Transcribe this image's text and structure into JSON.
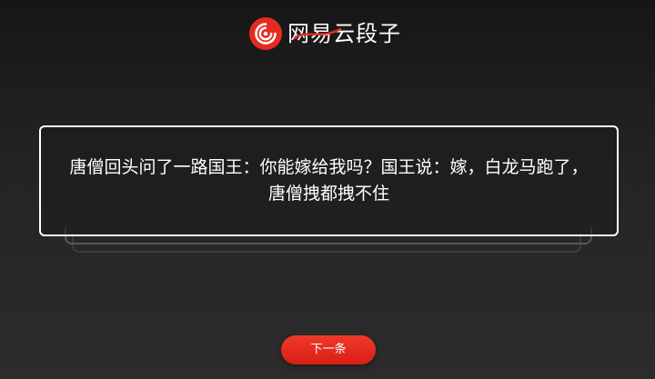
{
  "brand": {
    "name": "网易云段子",
    "icon": "netease-spiral-logo-icon",
    "accent_color": "#e52b1f"
  },
  "card": {
    "joke_text": "唐僧回头问了一路国王：你能嫁给我吗？国王说：嫁，白龙马跑了，唐僧拽都拽不住"
  },
  "actions": {
    "next_label": "下一条"
  }
}
